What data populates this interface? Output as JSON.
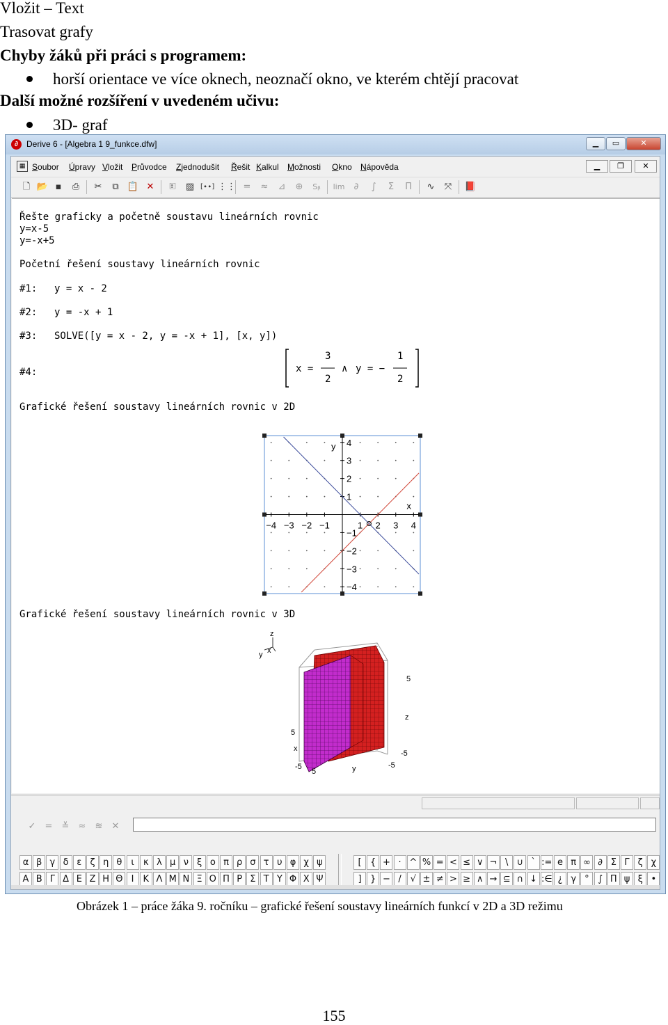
{
  "doc": {
    "line1": "Vložit – Text",
    "line2": "Trasovat grafy",
    "heading1": "Chyby žáků při práci s programem:",
    "bullet1": "horší orientace ve více oknech, neoznačí okno, ve kterém chtějí pracovat",
    "heading2": "Další možné rozšíření v uvedeném učivu:",
    "bullet2": "3D- graf",
    "caption": "Obrázek 1 – práce žáka 9. ročníku – grafické řešení soustavy lineárních funkcí v 2D a 3D režimu",
    "page_number": "155"
  },
  "window": {
    "title": "Derive 6 - [Algebra 1  9_funkce.dfw]",
    "menu": [
      "Soubor",
      "Úpravy",
      "Vložit",
      "Průvodce",
      "Zjednodušit",
      "Řešit",
      "Kalkul",
      "Možnosti",
      "Okno",
      "Nápověda"
    ],
    "toolbar_icons": [
      "new-file-icon",
      "open-folder-icon",
      "save-icon",
      "print-icon",
      "cut-icon",
      "copy-icon",
      "paste-icon",
      "delete-icon",
      "insert-text-icon",
      "insert-picture-icon",
      "vector-icon",
      "matrix-icon",
      "equals-icon",
      "approx-icon",
      "solve-icon",
      "zoom-icon",
      "substitute-icon",
      "limit-icon",
      "derivative-icon",
      "integral-icon",
      "sum-icon",
      "product-icon",
      "2d-plot-icon",
      "3d-plot-icon",
      "book-icon"
    ]
  },
  "worksheet": {
    "task_line": "Řešte graficky a početně soustavu lineárních rovnic",
    "eq1": "y=x-5",
    "eq2": "y=-x+5",
    "section_numeric": "Početní řešení soustavy lineárních rovnic",
    "rows": [
      {
        "label": "#1:",
        "expr": "y = x - 2"
      },
      {
        "label": "#2:",
        "expr": "y = -x + 1"
      },
      {
        "label": "#3:",
        "expr": "SOLVE([y = x - 2, y = -x + 1], [x, y])"
      },
      {
        "label": "#4:",
        "expr": ""
      }
    ],
    "solution": {
      "x_eq": "x =",
      "x_num": "3",
      "x_den": "2",
      "and": "∧",
      "y_eq": "y = −",
      "y_num": "1",
      "y_den": "2"
    },
    "section_2d": "Grafické řešení soustavy lineárních rovnic v 2D",
    "section_3d": "Grafické řešení soustavy lineárních rovnic v 3D",
    "plot3d_labels": {
      "z_top": "z",
      "y_top": "y",
      "x_top": "x",
      "five_r": "5",
      "z_r": "z",
      "neg5_r": "-5",
      "five_l": "5",
      "x_l": "x",
      "neg5_bl": "-5",
      "five_b": "5",
      "y_b": "y",
      "neg5_b": "-5"
    }
  },
  "chart_data": {
    "type": "line",
    "xlabel": "x",
    "ylabel": "y",
    "xlim": [
      -4.3,
      4.3
    ],
    "ylim": [
      -4.3,
      4.3
    ],
    "x_ticks": [
      -4,
      -3,
      -2,
      -1,
      1,
      2,
      3,
      4
    ],
    "y_ticks": [
      -4,
      -3,
      -2,
      -1,
      1,
      2,
      3,
      4
    ],
    "grid": "dots",
    "series": [
      {
        "slope": 1,
        "intercept": -2,
        "color": "#d24a3c"
      },
      {
        "slope": -1,
        "intercept": 1,
        "color": "#3a4a9a"
      }
    ],
    "intersection": [
      1.5,
      -0.5
    ]
  },
  "symbols": {
    "row1_greek": [
      "α",
      "β",
      "γ",
      "δ",
      "ε",
      "ζ",
      "η",
      "θ",
      "ι",
      "κ",
      "λ",
      "μ",
      "ν",
      "ξ",
      "ο",
      "π",
      "ρ",
      "σ",
      "τ",
      "υ",
      "φ",
      "χ",
      "ψ"
    ],
    "row2_greek": [
      "Α",
      "Β",
      "Γ",
      "Δ",
      "Ε",
      "Ζ",
      "Η",
      "Θ",
      "Ι",
      "Κ",
      "Λ",
      "Μ",
      "Ν",
      "Ξ",
      "Ο",
      "Π",
      "Ρ",
      "Σ",
      "Τ",
      "Υ",
      "Φ",
      "Χ",
      "Ψ"
    ],
    "row1_ops": [
      "[",
      "{",
      "+",
      "·",
      "^",
      "%",
      "=",
      "<",
      "≤",
      "∨",
      "¬",
      "\\",
      "∪",
      "`",
      ":=",
      "e",
      "π",
      "∞",
      "∂",
      "Σ",
      "Γ",
      "ζ",
      "χ"
    ],
    "row2_ops": [
      "]",
      "}",
      "−",
      "/",
      "√",
      "±",
      "≠",
      ">",
      "≥",
      "∧",
      "→",
      "⊆",
      "∩",
      "↓",
      ":∈",
      "¿",
      "γ",
      "°",
      "∫",
      "Π",
      "ψ",
      "ξ",
      "•"
    ]
  },
  "colors": {
    "plane_red": "#d42020",
    "plane_magenta": "#c22ccc",
    "line_red": "#d24a3c",
    "line_blue": "#3a4a9a",
    "selection": "#5b8fd6"
  }
}
